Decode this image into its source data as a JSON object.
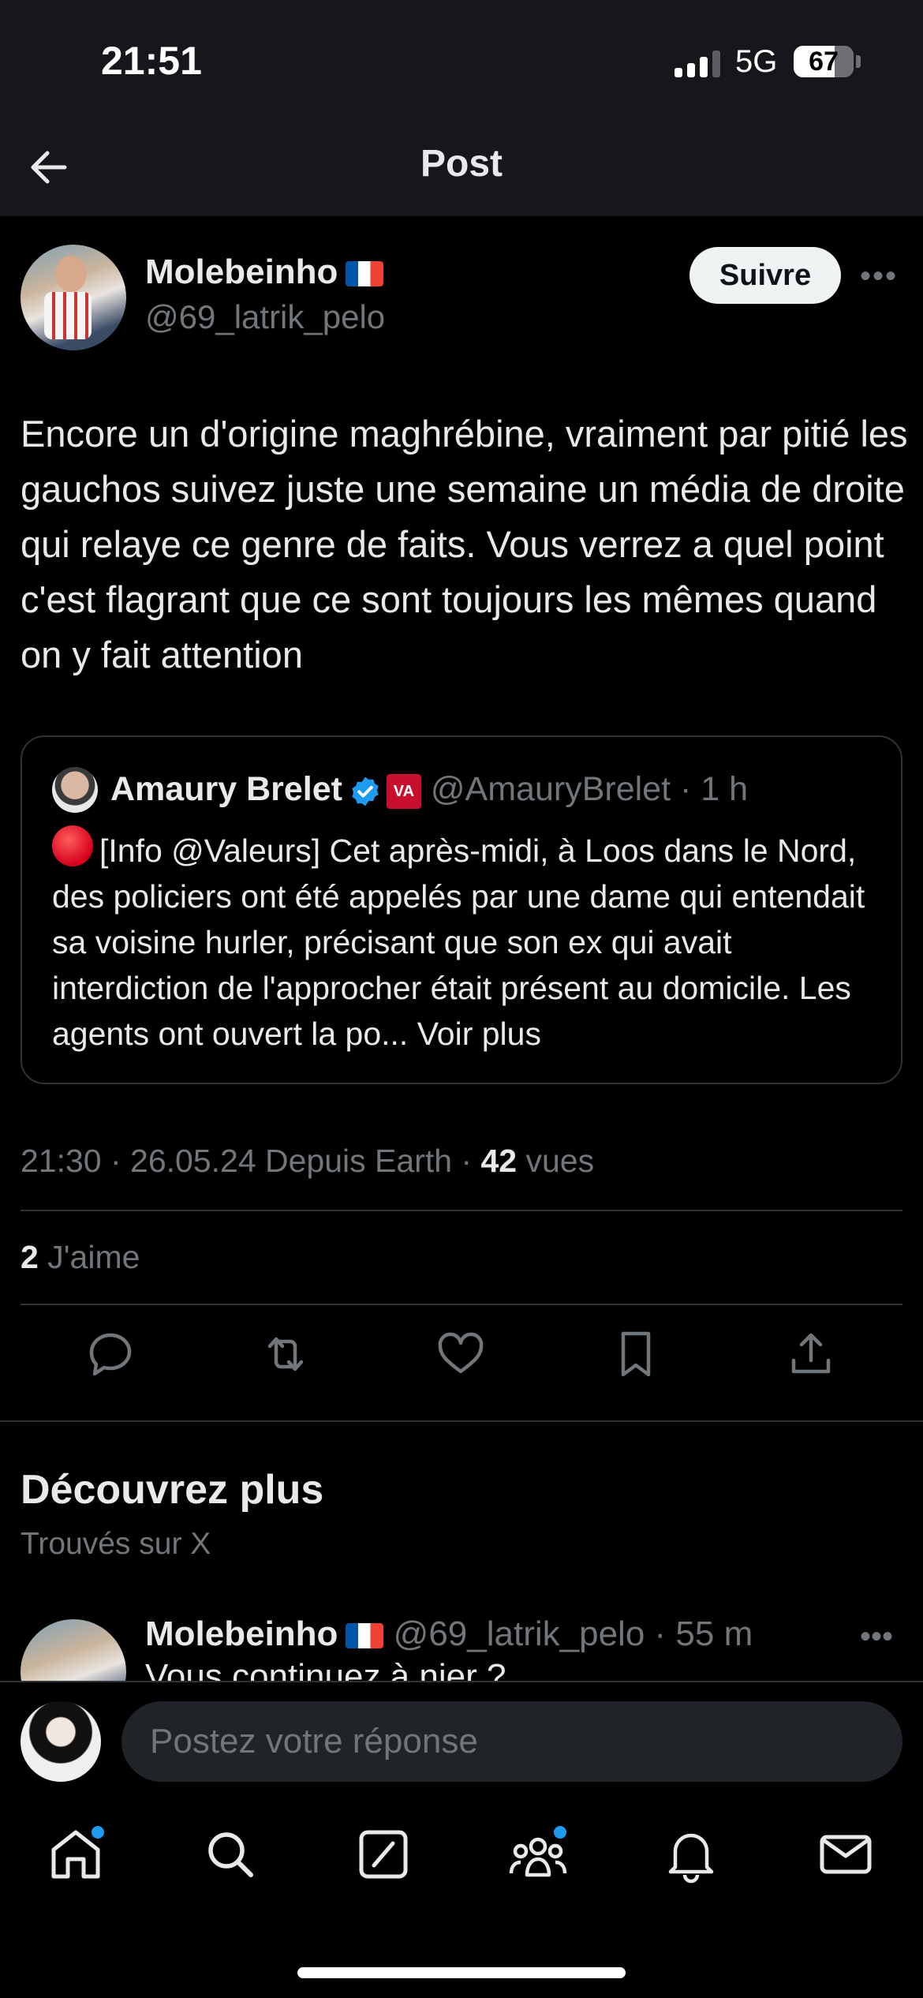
{
  "status_bar": {
    "time": "21:51",
    "network": "5G",
    "battery": "67",
    "signal_bars": 3
  },
  "nav": {
    "title": "Post",
    "back_icon": "arrow-left-icon"
  },
  "post": {
    "author_name": "Molebeinho",
    "author_handle": "@69_latrik_pelo",
    "flag": "🇫🇷",
    "follow_label": "Suivre",
    "text": "Encore un d'origine maghrébine, vraiment par pitié les gauchos suivez juste une semaine un média de droite qui relaye ce genre de faits. Vous verrez a quel point c'est flagrant que ce sont toujours les mêmes quand on y fait attention",
    "time_date": "21:30 · 26.05.24 Depuis Earth · ",
    "views_count": "42",
    "views_label": " vues",
    "likes_count": "2",
    "likes_label": " J'aime"
  },
  "quote": {
    "name": "Amaury Brelet",
    "badge": "VA",
    "handle_time": "@AmauryBrelet · 1 h",
    "text": "[Info @Valeurs] Cet après-midi, à Loos dans le Nord, des policiers ont été appelés par une dame qui entendait sa voisine hurler, précisant que son ex qui avait interdiction de l'approcher était présent au domicile. Les agents ont ouvert la po... ",
    "see_more": "Voir plus"
  },
  "actions": [
    "reply-icon",
    "retweet-icon",
    "like-icon",
    "bookmark-icon",
    "share-icon"
  ],
  "discover": {
    "title": "Découvrez plus",
    "subtitle": "Trouvés sur X",
    "next_author": "Molebeinho",
    "next_meta": "@69_latrik_pelo · 55 m",
    "next_text": "Vous continuez à nier ?"
  },
  "reply": {
    "placeholder": "Postez votre réponse"
  },
  "tabs": [
    "home-icon",
    "search-icon",
    "grok-icon",
    "communities-icon",
    "notifications-icon",
    "messages-icon"
  ],
  "colors": {
    "background": "#000000",
    "text": "#e7e9ea",
    "muted": "#71767b",
    "accent": "#1d9bf0"
  }
}
